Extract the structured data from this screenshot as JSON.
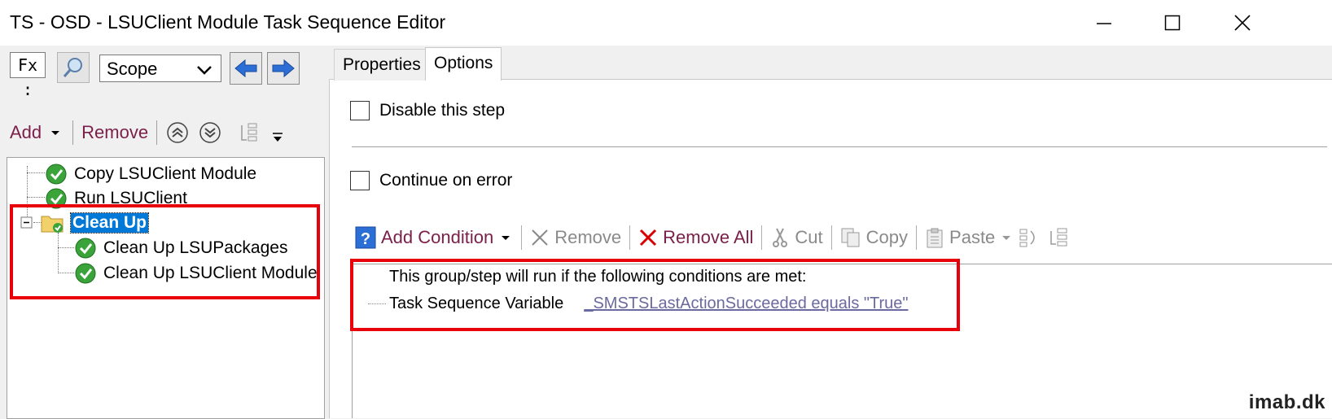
{
  "window": {
    "title": "TS - OSD - LSUClient Module Task Sequence Editor"
  },
  "left_toolbar": {
    "fx_label": "Fx :",
    "scope_value": "Scope",
    "add_label": "Add",
    "remove_label": "Remove"
  },
  "tree": {
    "items": [
      {
        "label": "Copy LSUClient Module",
        "icon": "check-icon"
      },
      {
        "label": "Run LSUClient",
        "icon": "check-icon"
      },
      {
        "label": "Clean Up",
        "icon": "folder-icon",
        "selected": true
      },
      {
        "label": "Clean Up LSUPackages",
        "icon": "check-icon"
      },
      {
        "label": "Clean Up LSUClient Module",
        "icon": "check-icon"
      }
    ]
  },
  "tabs": {
    "properties": "Properties",
    "options": "Options"
  },
  "options": {
    "disable_label": "Disable this step",
    "continue_label": "Continue on error"
  },
  "condition_toolbar": {
    "add_condition": "Add Condition",
    "remove": "Remove",
    "remove_all": "Remove All",
    "cut": "Cut",
    "copy": "Copy",
    "paste": "Paste"
  },
  "conditions": {
    "header": "This group/step will run if the following conditions are met:",
    "item_label": "Task Sequence Variable",
    "item_value": "_SMSTSLastActionSucceeded equals \"True\""
  },
  "watermark": "imab.dk",
  "colors": {
    "highlight": "#e8000b",
    "selection": "#0078d7",
    "check_green": "#3aa33a"
  }
}
